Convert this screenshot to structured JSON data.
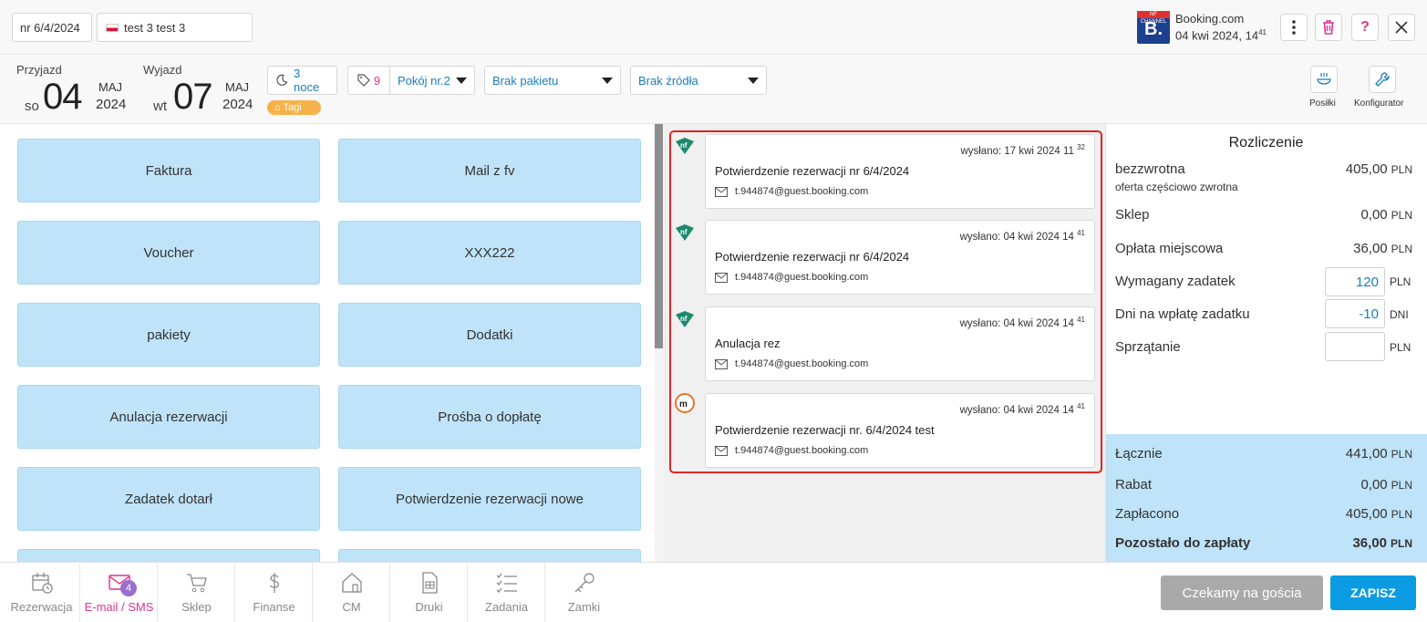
{
  "header": {
    "reservation_no": "nr 6/4/2024",
    "guest_name": "test 3 test 3",
    "channel_badge": "NF CHANNEL",
    "channel_letter": "B.",
    "channel_name": "Booking.com",
    "channel_date": "04 kwi 2024, 14",
    "channel_date_sup": "41"
  },
  "stay": {
    "arrival_label": "Przyjazd",
    "arrival_dow": "so",
    "arrival_day": "04",
    "arrival_month": "MAJ",
    "arrival_year": "2024",
    "departure_label": "Wyjazd",
    "departure_dow": "wt",
    "departure_day": "07",
    "departure_month": "MAJ",
    "departure_year": "2024",
    "nights": "3 noce",
    "tag_count": "9",
    "room": "Pokój nr.2",
    "package": "Brak pakietu",
    "source": "Brak źródła",
    "tags_label": "Tagi",
    "meals_label": "Posiłki",
    "configurator_label": "Konfigurator"
  },
  "templates": [
    "Faktura",
    "Mail z fv",
    "Voucher",
    "XXX222",
    "pakiety",
    "Dodatki",
    "Anulacja rezerwacji",
    "Prośba o dopłatę",
    "Zadatek dotarł",
    "Potwierdzenie rezerwacji nowe"
  ],
  "messages": [
    {
      "sent": "wysłano: 17 kwi 2024 11",
      "sent_sup": "32",
      "subject": "Potwierdzenie rezerwacji nr 6/4/2024",
      "email": "t.944874@guest.booking.com",
      "source_icon": "nf-logo-icon"
    },
    {
      "sent": "wysłano: 04 kwi 2024 14",
      "sent_sup": "41",
      "subject": "Potwierdzenie rezerwacji nr 6/4/2024",
      "email": "t.944874@guest.booking.com",
      "source_icon": "nf-logo-icon"
    },
    {
      "sent": "wysłano: 04 kwi 2024 14",
      "sent_sup": "41",
      "subject": "Anulacja rez",
      "email": "t.944874@guest.booking.com",
      "source_icon": "nf-logo-icon"
    },
    {
      "sent": "wysłano: 04 kwi 2024 14",
      "sent_sup": "41",
      "subject": "Potwierdzenie rezerwacji nr. 6/4/2024 test",
      "email": "t.944874@guest.booking.com",
      "source_icon": "mf-circle-icon"
    }
  ],
  "settlement": {
    "title": "Rozliczenie",
    "items": [
      {
        "label": "bezzwrotna",
        "value": "405,00",
        "currency": "PLN"
      },
      {
        "label": "Sklep",
        "value": "0,00",
        "currency": "PLN"
      },
      {
        "label": "Opłata miejscowa",
        "value": "36,00",
        "currency": "PLN"
      }
    ],
    "note": "oferta częściowo zwrotna",
    "deposit_label": "Wymagany zadatek",
    "deposit_value": "120",
    "deposit_unit": "PLN",
    "days_label": "Dni na wpłatę zadatku",
    "days_value": "-10",
    "days_unit": "DNI",
    "cleaning_label": "Sprzątanie",
    "cleaning_value": "",
    "cleaning_unit": "PLN",
    "total_label": "Łącznie",
    "total_value": "441,00",
    "discount_label": "Rabat",
    "discount_value": "0,00",
    "paid_label": "Zapłacono",
    "paid_value": "405,00",
    "remaining_label": "Pozostało do zapłaty",
    "remaining_value": "36,00",
    "currency": "PLN"
  },
  "nav": [
    {
      "label": "Rezerwacja",
      "icon": "calendar-clock-icon"
    },
    {
      "label": "E-mail / SMS",
      "icon": "envelope-icon",
      "badge": "4"
    },
    {
      "label": "Sklep",
      "icon": "cart-icon"
    },
    {
      "label": "Finanse",
      "icon": "dollar-icon"
    },
    {
      "label": "CM",
      "icon": "house-icon"
    },
    {
      "label": "Druki",
      "icon": "document-icon"
    },
    {
      "label": "Zadania",
      "icon": "checklist-icon"
    },
    {
      "label": "Zamki",
      "icon": "key-icon"
    }
  ],
  "actions": {
    "waiting_label": "Czekamy na gościa",
    "save_label": "ZAPISZ"
  },
  "colors": {
    "accent_blue": "#0b9be3",
    "tile_blue": "#bfe3f8",
    "highlight_red": "#e02424",
    "active_pink": "#e0358f",
    "tag_orange": "#f6b24a"
  }
}
